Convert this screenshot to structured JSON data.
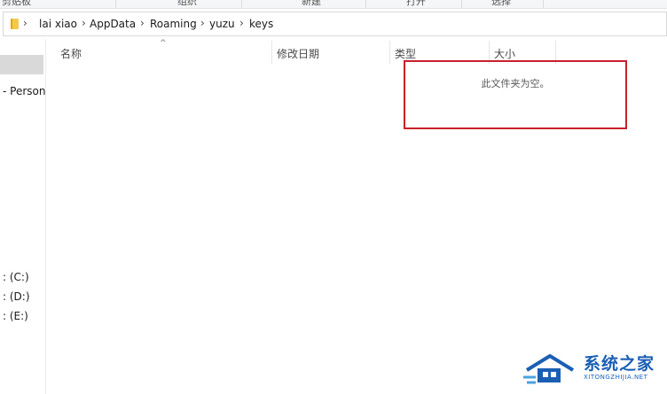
{
  "ribbon": {
    "groups": [
      "剪贴板",
      "组织",
      "新建",
      "打开",
      "选择"
    ]
  },
  "address_bar": {
    "crumbs": [
      "lai xiao",
      "AppData",
      "Roaming",
      "yuzu",
      "keys"
    ]
  },
  "nav_pane": {
    "items": [
      "- Persona",
      ": (C:)",
      ": (D:)",
      ": (E:)"
    ]
  },
  "columns": {
    "name": "名称",
    "date": "修改日期",
    "type": "类型",
    "size": "大小"
  },
  "content": {
    "empty_message": "此文件夹为空。"
  },
  "colors": {
    "highlight": "#c8202a",
    "watermark": "#1a5fb4",
    "selection": "#d9d9d9"
  },
  "watermark": {
    "brand_cn": "系统之家",
    "brand_en": "XITONGZHIJIA.NET"
  }
}
